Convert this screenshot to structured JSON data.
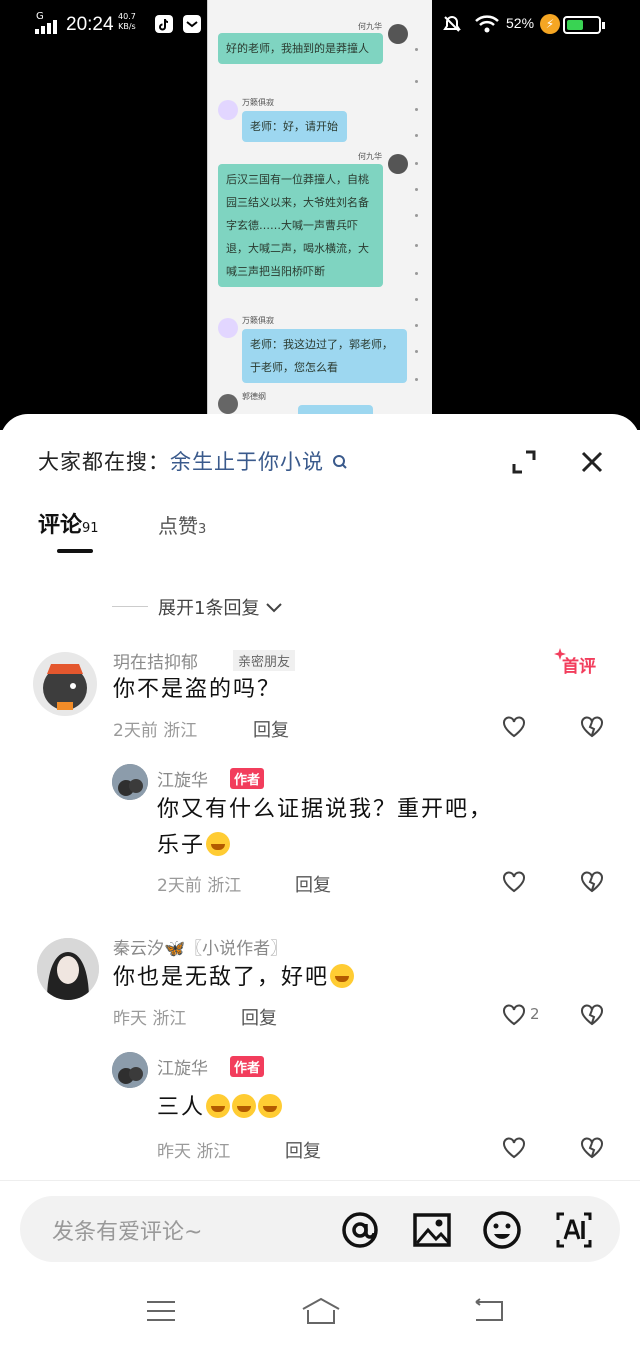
{
  "status_bar": {
    "net_type": "G",
    "time": "20:24",
    "net_speed": "40.7",
    "net_unit": "KB/s",
    "battery": "52%"
  },
  "chat_preview": {
    "messages": [
      {
        "sender": "何九华",
        "text": "好的老师，我抽到的是莽撞人"
      },
      {
        "sender": "万籁俱寂",
        "text": "老师：好，请开始"
      },
      {
        "sender": "何九华",
        "text": "后汉三国有一位莽撞人，自桃园三结义以来，大爷姓刘名备字玄德……大喊一声曹兵吓退，大喊二声，喝水横流，大喊三声把当阳桥吓断"
      },
      {
        "sender": "万籁俱寂",
        "text": "老师：我这边过了，郭老师，于老师，您怎么看"
      },
      {
        "sender": "郭德纲",
        "text": ""
      }
    ]
  },
  "header": {
    "search_prefix": "大家都在搜：",
    "search_keyword": "余生止于你小说"
  },
  "tabs": [
    {
      "label": "评论",
      "count": "91"
    },
    {
      "label": "点赞",
      "count": "3"
    }
  ],
  "expand_replies": "展开1条回复",
  "first_comment_badge": "首评",
  "comments": [
    {
      "name": "玥在拮抑郁",
      "tag": "亲密朋友",
      "text": "你不是盗的吗？",
      "meta": "2天前 浙江",
      "reply": "回复"
    },
    {
      "name": "江旋华",
      "author_badge": "作者",
      "text_line1": "你又有什么证据说我？重开吧，",
      "text_line2": "乐子",
      "meta": "2天前 浙江",
      "reply": "回复"
    },
    {
      "name": "秦云汐🦋〖小说作者〗",
      "text": "你也是无敌了，好吧",
      "meta": "昨天 浙江",
      "reply": "回复",
      "likes": "2"
    },
    {
      "name": "江旋华",
      "author_badge": "作者",
      "text": "三人",
      "meta": "昨天 浙江",
      "reply": "回复"
    }
  ],
  "input": {
    "placeholder": "发条有爱评论~"
  },
  "colors": {
    "accent": "#f23d5c",
    "keyword": "#3a5a8c",
    "bubble_green": "#7fd4c1",
    "bubble_blue": "#9dd7f0"
  }
}
